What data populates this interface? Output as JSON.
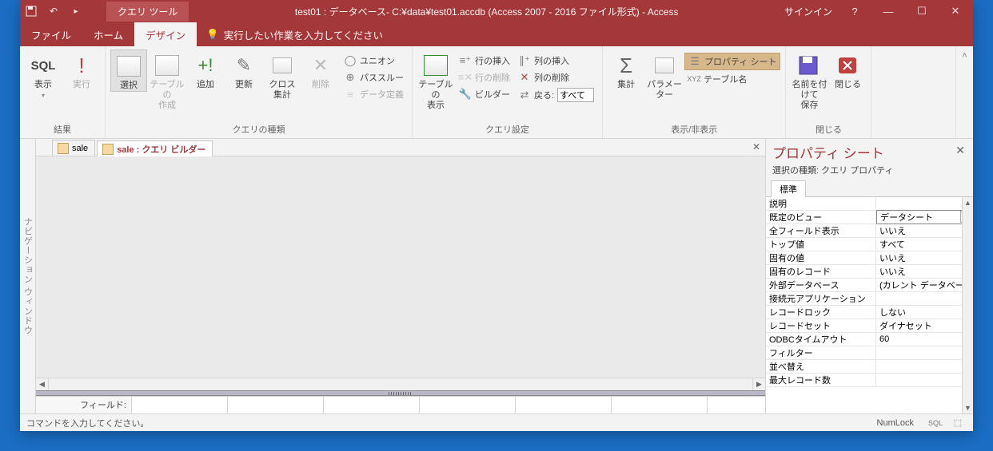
{
  "titlebar": {
    "context_tab": "クエリ ツール",
    "title": "test01 : データベース- C:¥data¥test01.accdb (Access 2007 - 2016 ファイル形式) - Access",
    "signin": "サインイン"
  },
  "tabs": {
    "file": "ファイル",
    "home": "ホーム",
    "design": "デザイン",
    "tellme": "実行したい作業を入力してください"
  },
  "ribbon": {
    "results": {
      "view": "表示",
      "run": "実行",
      "group": "結果",
      "sql": "SQL"
    },
    "qtype": {
      "select": "選択",
      "make_table": "テーブルの\n作成",
      "append": "追加",
      "update": "更新",
      "crosstab": "クロス\n集計",
      "delete": "削除",
      "union": "ユニオン",
      "passthrough": "パススルー",
      "datadef": "データ定義",
      "group": "クエリの種類"
    },
    "setup": {
      "show_table": "テーブルの\n表示",
      "row_insert": "行の挿入",
      "row_delete": "行の削除",
      "builder": "ビルダー",
      "col_insert": "列の挿入",
      "col_delete": "列の削除",
      "return_label": "戻る:",
      "return_value": "すべて",
      "group": "クエリ設定"
    },
    "showhide": {
      "totals": "集計",
      "parameters": "パラメーター",
      "prop_sheet": "プロパティ シート",
      "table_names": "テーブル名",
      "group": "表示/非表示"
    },
    "close": {
      "saveas": "名前を付けて\n保存",
      "close": "閉じる",
      "group": "閉じる"
    }
  },
  "nav": {
    "label": "ナビゲーション ウィンドウ"
  },
  "obj_tabs": {
    "sale": "sale",
    "builder": "sale : クエリ ビルダー"
  },
  "qgrid": {
    "field": "フィールド:"
  },
  "prop": {
    "title": "プロパティ シート",
    "subtitle": "選択の種類: クエリ プロパティ",
    "tab": "標準",
    "rows": [
      {
        "name": "説明",
        "value": ""
      },
      {
        "name": "既定のビュー",
        "value": "データシート"
      },
      {
        "name": "全フィールド表示",
        "value": "いいえ"
      },
      {
        "name": "トップ値",
        "value": "すべて"
      },
      {
        "name": "固有の値",
        "value": "いいえ"
      },
      {
        "name": "固有のレコード",
        "value": "いいえ"
      },
      {
        "name": "外部データベース",
        "value": "(カレント データベー"
      },
      {
        "name": "接続元アプリケーション",
        "value": ""
      },
      {
        "name": "レコードロック",
        "value": "しない"
      },
      {
        "name": "レコードセット",
        "value": "ダイナセット"
      },
      {
        "name": "ODBCタイムアウト",
        "value": "60"
      },
      {
        "name": "フィルター",
        "value": ""
      },
      {
        "name": "並べ替え",
        "value": ""
      },
      {
        "name": "最大レコード数",
        "value": ""
      }
    ]
  },
  "status": {
    "prompt": "コマンドを入力してください。",
    "numlock": "NumLock",
    "sql": "SQL"
  }
}
